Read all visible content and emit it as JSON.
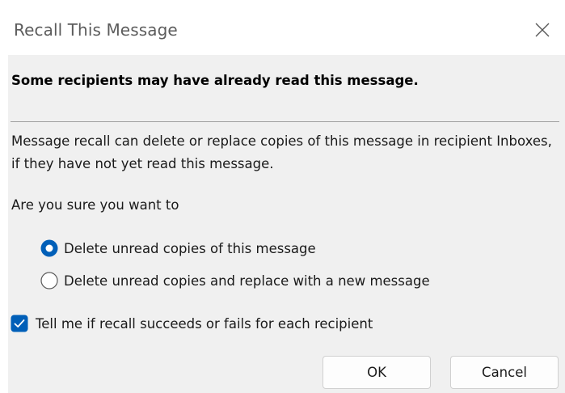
{
  "window": {
    "title": "Recall This Message",
    "close_icon": "close-icon"
  },
  "dialog": {
    "warning": "Some recipients may have already read this message.",
    "description": "Message recall can delete or replace copies of this message in recipient Inboxes, if they have not yet read this message.",
    "question": "Are you sure you want to",
    "options": [
      {
        "label": "Delete unread copies of this message",
        "selected": true
      },
      {
        "label": "Delete unread copies and replace with a new message",
        "selected": false
      }
    ],
    "notify_checkbox": {
      "label": "Tell me if recall succeeds or fails for each recipient",
      "checked": true
    },
    "buttons": {
      "ok": "OK",
      "cancel": "Cancel"
    }
  },
  "colors": {
    "accent": "#005fb8",
    "client_background": "#f0f0f0",
    "title_text": "#5c5c5c"
  }
}
